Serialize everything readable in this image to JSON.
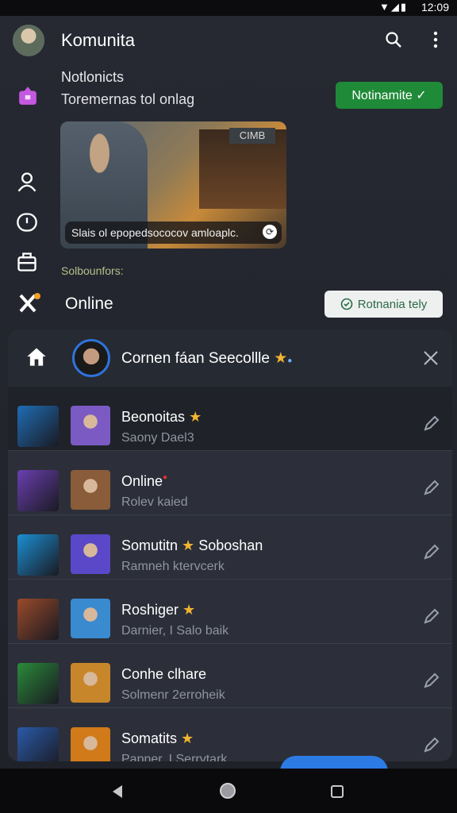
{
  "status_bar": {
    "time": "12:09"
  },
  "header": {
    "title": "Komunita"
  },
  "notification": {
    "title": "Notlonicts",
    "subtitle": "Toremernas tol onlag",
    "button_label": "Notinamite ✓"
  },
  "banner": {
    "sign": "CIMB",
    "caption": "Slais ol epopedsococov amloaplc."
  },
  "section_label": "Solbounfors:",
  "online": {
    "heading": "Online",
    "button_label": "Rotnania tely"
  },
  "panel_header": {
    "title": "Cornen fáan Seecollle"
  },
  "rows": [
    {
      "name": "Beonoitas",
      "sub": "Saony Dael3",
      "badge": "star",
      "colors": [
        "#1f6db5",
        "#7b5ac4"
      ]
    },
    {
      "name": "Online",
      "sub": "Rolev kaied",
      "badge": "dot",
      "colors": [
        "#6a3fb0",
        "#8a5c3a"
      ]
    },
    {
      "name": "Somutitn",
      "name_suffix": "Soboshan",
      "sub": "Ramneh ktervcerk",
      "badge": "star",
      "colors": [
        "#1b8fd3",
        "#5a48c8"
      ]
    },
    {
      "name": "Roshiger",
      "sub": "Darnier, I Salo baik",
      "badge": "star",
      "colors": [
        "#9a4a2a",
        "#3a8ad0"
      ]
    },
    {
      "name": "Conhe clhare",
      "sub": "Solmenr 2erroheik",
      "badge": "",
      "colors": [
        "#2a8a3a",
        "#c8862a"
      ]
    },
    {
      "name": "Somatits",
      "sub": "Papner, I Serrvtark",
      "badge": "star",
      "colors": [
        "#2a5aa8",
        "#d07a1a"
      ]
    }
  ],
  "colors": {
    "accent_green": "#1f8a38",
    "accent_blue": "#2c7be5",
    "background": "#23252d"
  },
  "icons": [
    "search-icon",
    "more-vert-icon",
    "notification-icon",
    "person-icon",
    "clock-icon",
    "briefcase-icon",
    "tools-icon",
    "home-icon",
    "close-icon",
    "edit-icon"
  ]
}
